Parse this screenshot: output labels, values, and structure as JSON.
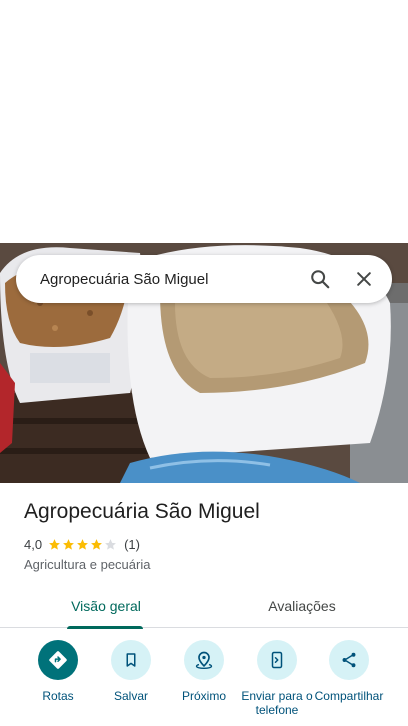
{
  "search": {
    "query": "Agropecuária São Miguel"
  },
  "place": {
    "name": "Agropecuária São Miguel",
    "rating_value": "4,0",
    "rating_stars": 4,
    "review_count": "(1)",
    "category": "Agricultura e pecuária"
  },
  "tabs": [
    {
      "label": "Visão geral",
      "selected": true
    },
    {
      "label": "Avaliações",
      "selected": false
    }
  ],
  "actions": [
    {
      "label": "Rotas",
      "icon": "directions-icon"
    },
    {
      "label": "Salvar",
      "icon": "bookmark-icon"
    },
    {
      "label": "Próximo",
      "icon": "nearby-icon"
    },
    {
      "label": "Enviar para o telefone",
      "icon": "send-to-phone-icon"
    },
    {
      "label": "Compartilhar",
      "icon": "share-icon"
    }
  ],
  "colors": {
    "accent": "#00695c",
    "primary_action": "#00727a",
    "action_bg": "#d6f2f6",
    "star": "#fbbc04"
  }
}
